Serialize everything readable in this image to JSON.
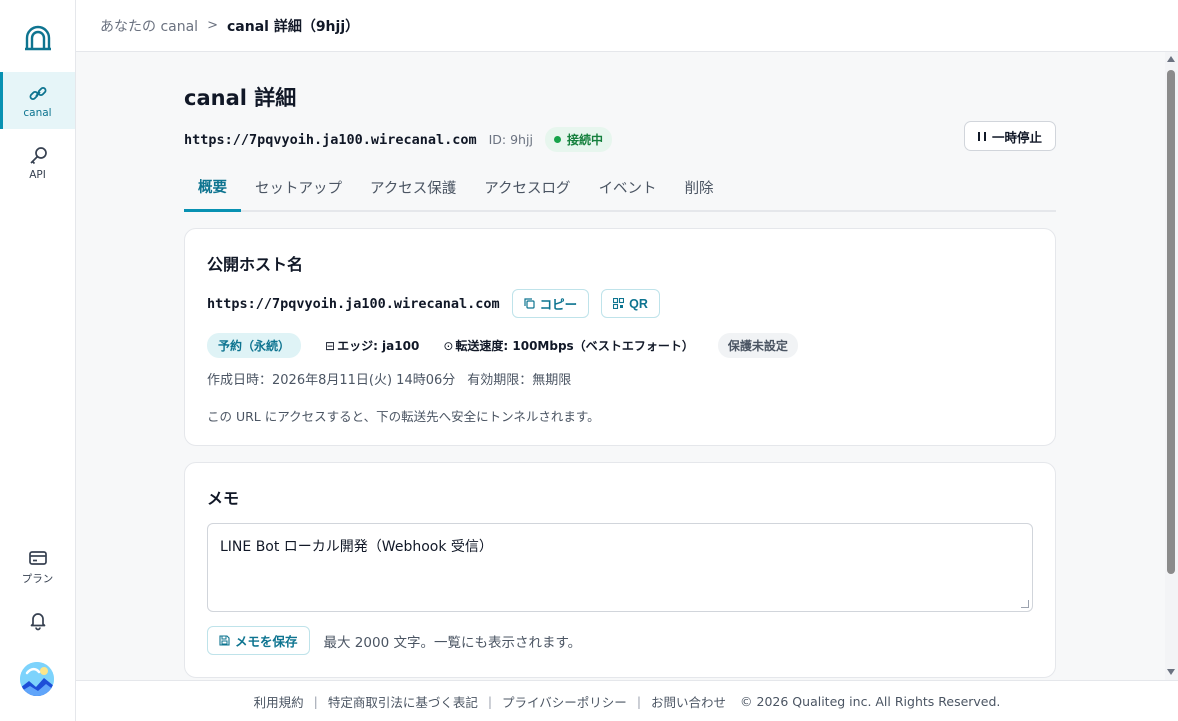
{
  "sidebar": {
    "logo_icon": "tunnel-logo-icon",
    "items": [
      {
        "label": "canal",
        "icon": "link-icon",
        "active": true
      },
      {
        "label": "API",
        "icon": "key-icon",
        "active": false
      }
    ],
    "bottom": [
      {
        "label": "プラン",
        "icon": "card-icon"
      },
      {
        "label": "",
        "icon": "bell-icon"
      }
    ]
  },
  "breadcrumb": {
    "parent": "あなたの canal",
    "separator": ">",
    "current": "canal 詳細（9hjj）"
  },
  "header": {
    "title": "canal 詳細",
    "url": "https://7pqvyoih.ja100.wirecanal.com",
    "id_text": "ID: 9hjj",
    "status": "接続中",
    "pause_label": "一時停止"
  },
  "tabs": [
    {
      "label": "概要",
      "active": true
    },
    {
      "label": "セットアップ",
      "active": false
    },
    {
      "label": "アクセス保護",
      "active": false
    },
    {
      "label": "アクセスログ",
      "active": false
    },
    {
      "label": "イベント",
      "active": false
    },
    {
      "label": "削除",
      "active": false
    }
  ],
  "public_host": {
    "title": "公開ホスト名",
    "url": "https://7pqvyoih.ja100.wirecanal.com",
    "copy_label": "コピー",
    "qr_label": "QR",
    "tag_reserved": "予約（永続）",
    "edge_icon": "⊟",
    "edge": "エッジ: ja100",
    "speed_icon": "⊙",
    "speed": "転送速度: 100Mbps（ベストエフォート）",
    "protection": "保護未設定",
    "created": "作成日時：2026年8月11日(火) 14時06分",
    "expiry": "有効期限：無期限",
    "description": "この URL にアクセスすると、下の転送先へ安全にトンネルされます。"
  },
  "memo": {
    "title": "メモ",
    "value": "LINE Bot ローカル開発（Webhook 受信）",
    "save_label": "メモを保存",
    "hint": "最大 2000 文字。一覧にも表示されます。"
  },
  "footer": {
    "links": [
      "利用規約",
      "特定商取引法に基づく表記",
      "プライバシーポリシー",
      "お問い合わせ"
    ],
    "separator": "|",
    "copyright": "© 2026 Qualiteg inc. All Rights Reserved."
  },
  "colors": {
    "accent": "#0891b2",
    "status_green": "#16a34a"
  }
}
